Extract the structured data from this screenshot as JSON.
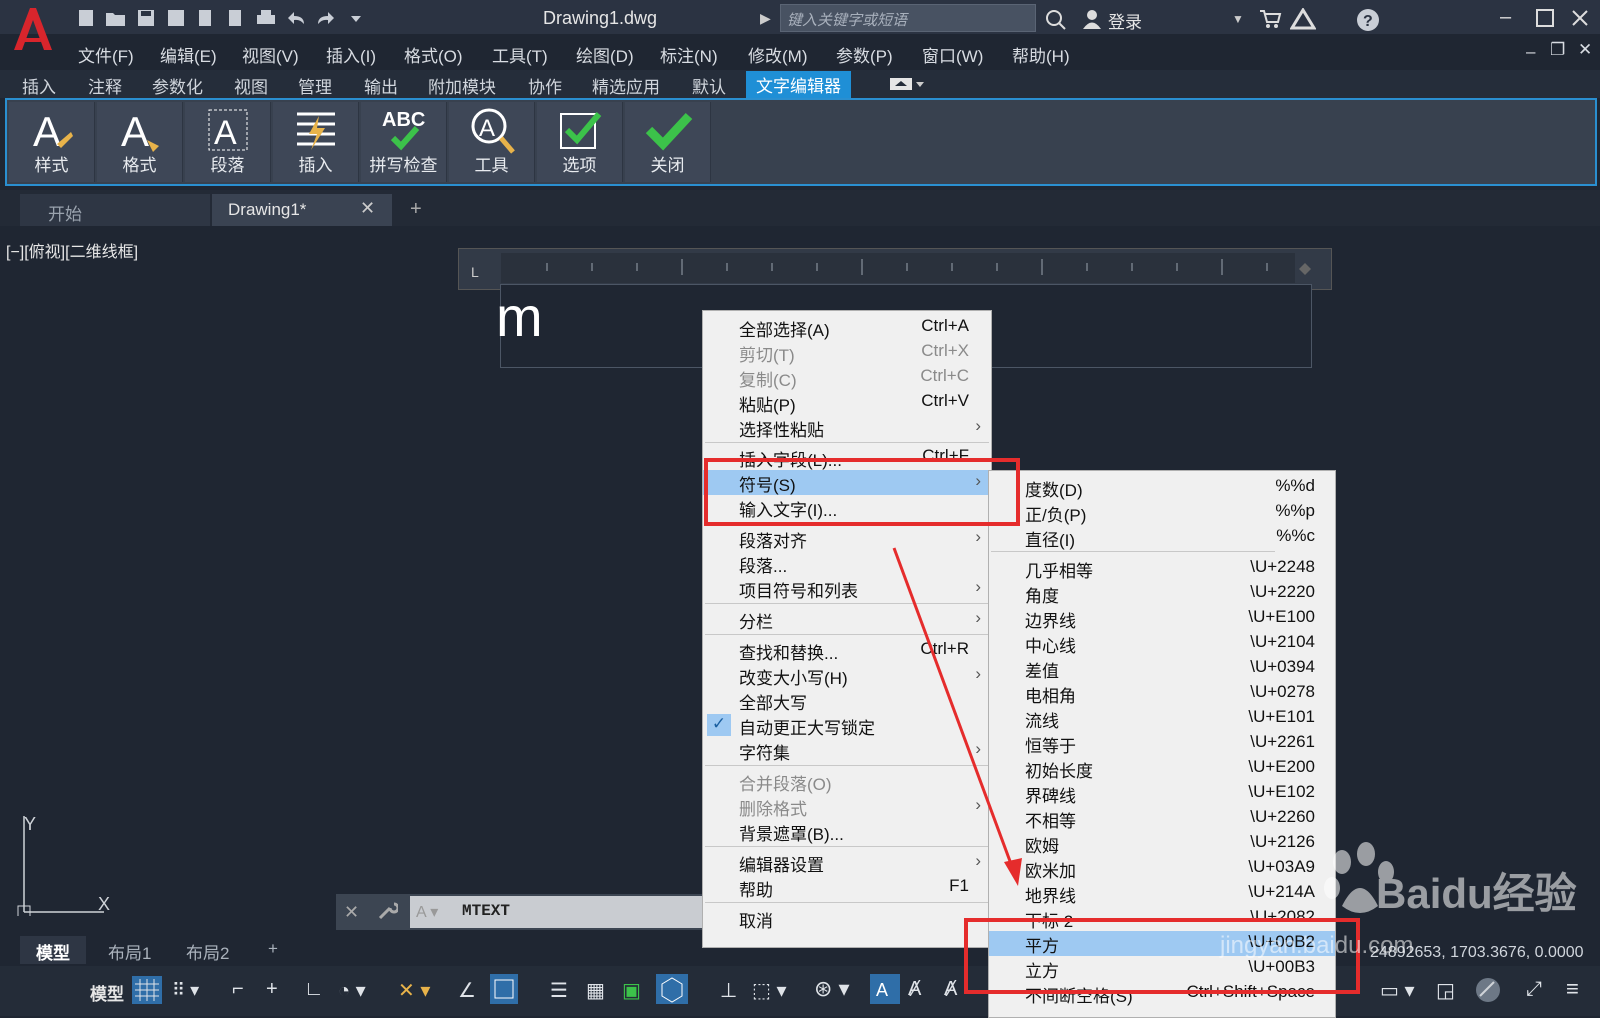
{
  "app": {
    "title": "Drawing1.dwg",
    "search_placeholder": "键入关键字或短语",
    "login": "登录"
  },
  "menubar": [
    "文件(F)",
    "编辑(E)",
    "视图(V)",
    "插入(I)",
    "格式(O)",
    "工具(T)",
    "绘图(D)",
    "标注(N)",
    "修改(M)",
    "参数(P)",
    "窗口(W)",
    "帮助(H)"
  ],
  "ribbon_tabs": [
    "插入",
    "注释",
    "参数化",
    "视图",
    "管理",
    "输出",
    "附加模块",
    "协作",
    "精选应用",
    "默认",
    "文字编辑器"
  ],
  "ribbon_buttons": [
    "样式",
    "格式",
    "段落",
    "插入",
    "拼写检查",
    "工具",
    "选项",
    "关闭"
  ],
  "ribbon_spell_abc": "ABC",
  "doc_tabs": {
    "start": "开始",
    "drawing": "Drawing1*",
    "add": "+"
  },
  "viewport_label": "[−][俯视][二维线框]",
  "mtext_content": "m",
  "command": {
    "text": "MTEXT"
  },
  "axis": {
    "y": "Y",
    "x": "X"
  },
  "layout_tabs": [
    "模型",
    "布局1",
    "布局2",
    "+"
  ],
  "status": {
    "model": "模型",
    "coords": "24892653, 1703.3676, 0.0000"
  },
  "context_menu": [
    {
      "label": "全部选择(A)",
      "shortcut": "Ctrl+A",
      "enabled": true
    },
    {
      "label": "剪切(T)",
      "shortcut": "Ctrl+X",
      "enabled": false
    },
    {
      "label": "复制(C)",
      "shortcut": "Ctrl+C",
      "enabled": false
    },
    {
      "label": "粘贴(P)",
      "shortcut": "Ctrl+V",
      "enabled": true
    },
    {
      "label": "选择性粘贴",
      "submenu": true,
      "enabled": true
    },
    {
      "label": "插入字段(L)...",
      "shortcut": "Ctrl+F",
      "enabled": true
    },
    {
      "label": "符号(S)",
      "submenu": true,
      "enabled": true,
      "highlighted": true
    },
    {
      "label": "输入文字(I)...",
      "enabled": true
    },
    {
      "label": "段落对齐",
      "submenu": true,
      "enabled": true
    },
    {
      "label": "段落...",
      "enabled": true
    },
    {
      "label": "项目符号和列表",
      "submenu": true,
      "enabled": true
    },
    {
      "label": "分栏",
      "submenu": true,
      "enabled": true
    },
    {
      "label": "查找和替换...",
      "shortcut": "Ctrl+R",
      "enabled": true
    },
    {
      "label": "改变大小写(H)",
      "submenu": true,
      "enabled": true
    },
    {
      "label": "全部大写",
      "enabled": true
    },
    {
      "label": "自动更正大写锁定",
      "enabled": true,
      "checked": true
    },
    {
      "label": "字符集",
      "submenu": true,
      "enabled": true
    },
    {
      "label": "合并段落(O)",
      "enabled": false
    },
    {
      "label": "删除格式",
      "submenu": true,
      "enabled": false
    },
    {
      "label": "背景遮罩(B)...",
      "enabled": true
    },
    {
      "label": "编辑器设置",
      "submenu": true,
      "enabled": true
    },
    {
      "label": "帮助",
      "shortcut": "F1",
      "enabled": true
    },
    {
      "label": "取消",
      "enabled": true
    }
  ],
  "symbol_menu": [
    {
      "label": "度数(D)",
      "code": "%%d"
    },
    {
      "label": "正/负(P)",
      "code": "%%p"
    },
    {
      "label": "直径(I)",
      "code": "%%c"
    },
    {
      "label": "几乎相等",
      "code": "\\U+2248"
    },
    {
      "label": "角度",
      "code": "\\U+2220"
    },
    {
      "label": "边界线",
      "code": "\\U+E100"
    },
    {
      "label": "中心线",
      "code": "\\U+2104"
    },
    {
      "label": "差值",
      "code": "\\U+0394"
    },
    {
      "label": "电相角",
      "code": "\\U+0278"
    },
    {
      "label": "流线",
      "code": "\\U+E101"
    },
    {
      "label": "恒等于",
      "code": "\\U+2261"
    },
    {
      "label": "初始长度",
      "code": "\\U+E200"
    },
    {
      "label": "界碑线",
      "code": "\\U+E102"
    },
    {
      "label": "不相等",
      "code": "\\U+2260"
    },
    {
      "label": "欧姆",
      "code": "\\U+2126"
    },
    {
      "label": "欧米加",
      "code": "\\U+03A9"
    },
    {
      "label": "地界线",
      "code": "\\U+214A"
    },
    {
      "label": "下标 2",
      "code": "\\U+2082"
    },
    {
      "label": "平方",
      "code": "\\U+00B2",
      "highlighted": true
    },
    {
      "label": "立方",
      "code": "\\U+00B3"
    },
    {
      "label": "不间断空格(S)",
      "code": "Ctrl+Shift+Space"
    }
  ],
  "watermark": {
    "text": "Baidu经验",
    "url": "jingyan.baidu.com"
  },
  "colors": {
    "accent": "#1f8fd6",
    "highlight": "#9ec9f2",
    "annotation": "#e52c2c"
  }
}
